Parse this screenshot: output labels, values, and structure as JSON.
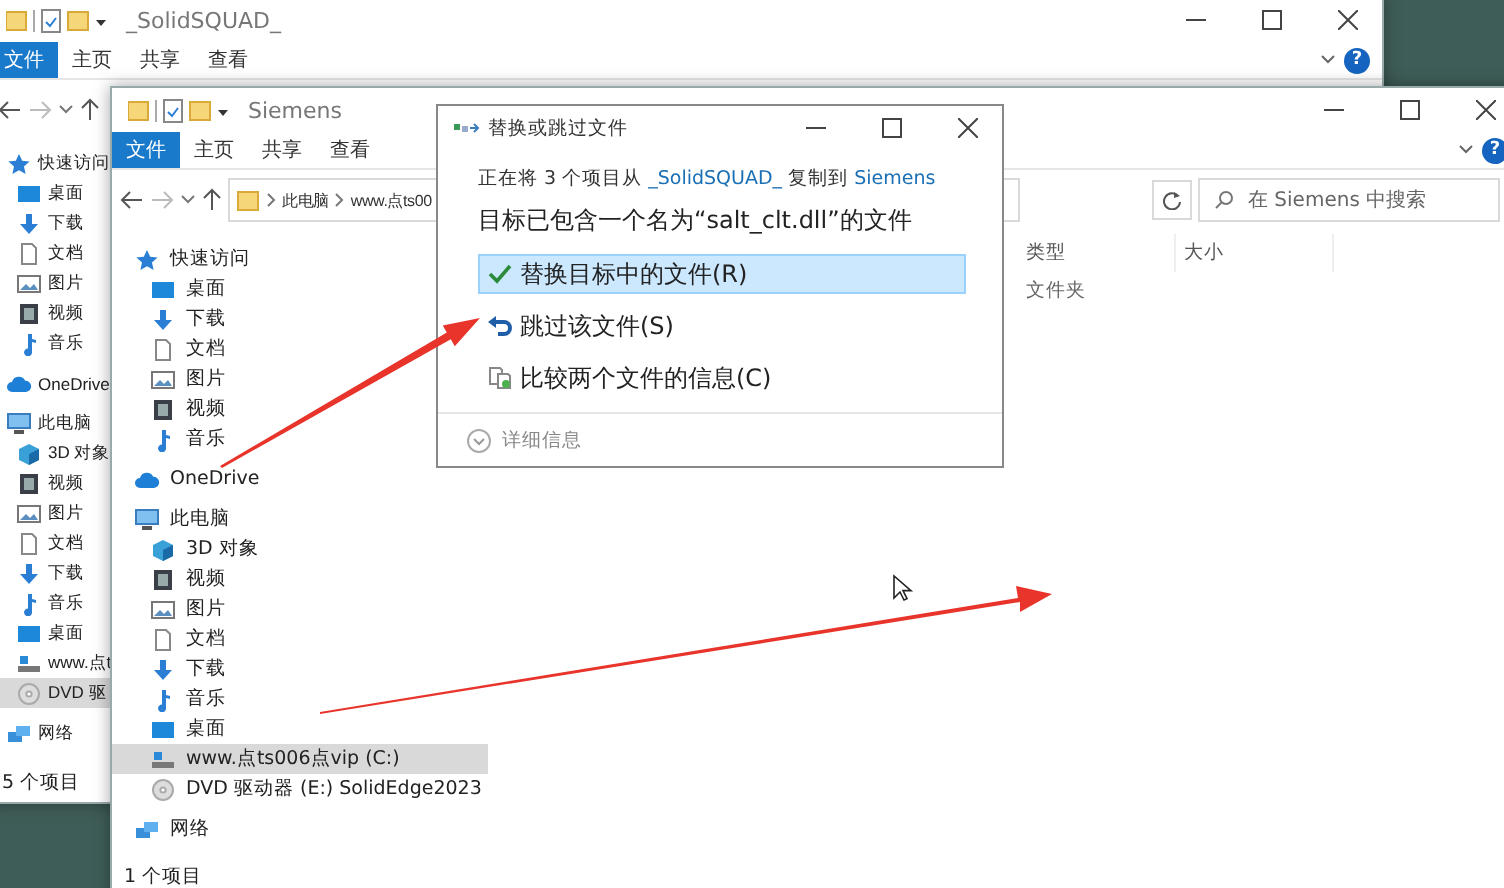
{
  "back_window": {
    "title": "_SolidSQUAD_",
    "tabs": [
      {
        "label": "文件",
        "selected": true
      },
      {
        "label": "主页",
        "selected": false
      },
      {
        "label": "共享",
        "selected": false
      },
      {
        "label": "查看",
        "selected": false
      }
    ],
    "help": "?",
    "sidebar": [
      {
        "label": "快速访问",
        "kind": "star",
        "selected": false,
        "children": [
          {
            "label": "桌面",
            "kind": "desktop",
            "selected": false
          },
          {
            "label": "下载",
            "kind": "download",
            "selected": false
          },
          {
            "label": "文档",
            "kind": "document",
            "selected": false
          },
          {
            "label": "图片",
            "kind": "picture",
            "selected": false
          },
          {
            "label": "视频",
            "kind": "video",
            "selected": false
          },
          {
            "label": "音乐",
            "kind": "music",
            "selected": false
          }
        ]
      },
      {
        "label": "OneDrive",
        "kind": "cloud",
        "selected": false
      },
      {
        "label": "此电脑",
        "kind": "pc",
        "selected": false,
        "children": [
          {
            "label": "3D 对象",
            "kind": "cube",
            "selected": false
          },
          {
            "label": "视频",
            "kind": "video",
            "selected": false
          },
          {
            "label": "图片",
            "kind": "picture",
            "selected": false
          },
          {
            "label": "文档",
            "kind": "document",
            "selected": false
          },
          {
            "label": "下载",
            "kind": "download",
            "selected": false
          },
          {
            "label": "音乐",
            "kind": "music",
            "selected": false
          },
          {
            "label": "桌面",
            "kind": "desktop",
            "selected": false
          },
          {
            "label": "www.点t",
            "kind": "drive",
            "selected": false
          },
          {
            "label": "DVD 驱",
            "kind": "dvd",
            "selected": true
          }
        ]
      },
      {
        "label": "网络",
        "kind": "network",
        "selected": false
      }
    ],
    "status_bar": "5 个项目"
  },
  "front_window": {
    "title": "Siemens",
    "tabs": [
      {
        "label": "文件",
        "selected": true
      },
      {
        "label": "主页",
        "selected": false
      },
      {
        "label": "共享",
        "selected": false
      },
      {
        "label": "查看",
        "selected": false
      }
    ],
    "help": "?",
    "breadcrumb": [
      "此电脑",
      "www.点ts00"
    ],
    "search": {
      "placeholder": "在 Siemens 中搜索"
    },
    "columns": [
      "类型",
      "大小"
    ],
    "rows": [
      [
        "文件夹"
      ]
    ],
    "sidebar": [
      {
        "label": "快速访问",
        "kind": "star",
        "selected": false,
        "children": [
          {
            "label": "桌面",
            "kind": "desktop",
            "selected": false
          },
          {
            "label": "下载",
            "kind": "download",
            "selected": false
          },
          {
            "label": "文档",
            "kind": "document",
            "selected": false
          },
          {
            "label": "图片",
            "kind": "picture",
            "selected": false
          },
          {
            "label": "视频",
            "kind": "video",
            "selected": false
          },
          {
            "label": "音乐",
            "kind": "music",
            "selected": false
          }
        ]
      },
      {
        "label": "OneDrive",
        "kind": "cloud",
        "selected": false
      },
      {
        "label": "此电脑",
        "kind": "pc",
        "selected": false,
        "children": [
          {
            "label": "3D 对象",
            "kind": "cube",
            "selected": false
          },
          {
            "label": "视频",
            "kind": "video",
            "selected": false
          },
          {
            "label": "图片",
            "kind": "picture",
            "selected": false
          },
          {
            "label": "文档",
            "kind": "document",
            "selected": false
          },
          {
            "label": "下载",
            "kind": "download",
            "selected": false
          },
          {
            "label": "音乐",
            "kind": "music",
            "selected": false
          },
          {
            "label": "桌面",
            "kind": "desktop",
            "selected": false
          },
          {
            "label": "www.点ts006点vip (C:)",
            "kind": "drive",
            "selected": true
          },
          {
            "label": "DVD 驱动器 (E:) SolidEdge2023",
            "kind": "dvd",
            "selected": false
          }
        ]
      },
      {
        "label": "网络",
        "kind": "network",
        "selected": false
      }
    ],
    "status_bar": "1 个项目"
  },
  "dialog": {
    "title": "替换或跳过文件",
    "message": [
      {
        "text": "正在将 3 个项目从 ",
        "kind": "plain"
      },
      {
        "text": "_SolidSQUAD_",
        "kind": "link"
      },
      {
        "text": " 复制到 ",
        "kind": "plain"
      },
      {
        "text": "Siemens",
        "kind": "link"
      }
    ],
    "heading": "目标已包含一个名为“salt_clt.dll”的文件",
    "options": [
      {
        "label": "替换目标中的文件(R)",
        "kind": "replace",
        "selected": true
      },
      {
        "label": "跳过该文件(S)",
        "kind": "skip",
        "selected": false
      },
      {
        "label": "比较两个文件的信息(C)",
        "kind": "compare",
        "selected": false
      }
    ],
    "details": "详细信息"
  }
}
